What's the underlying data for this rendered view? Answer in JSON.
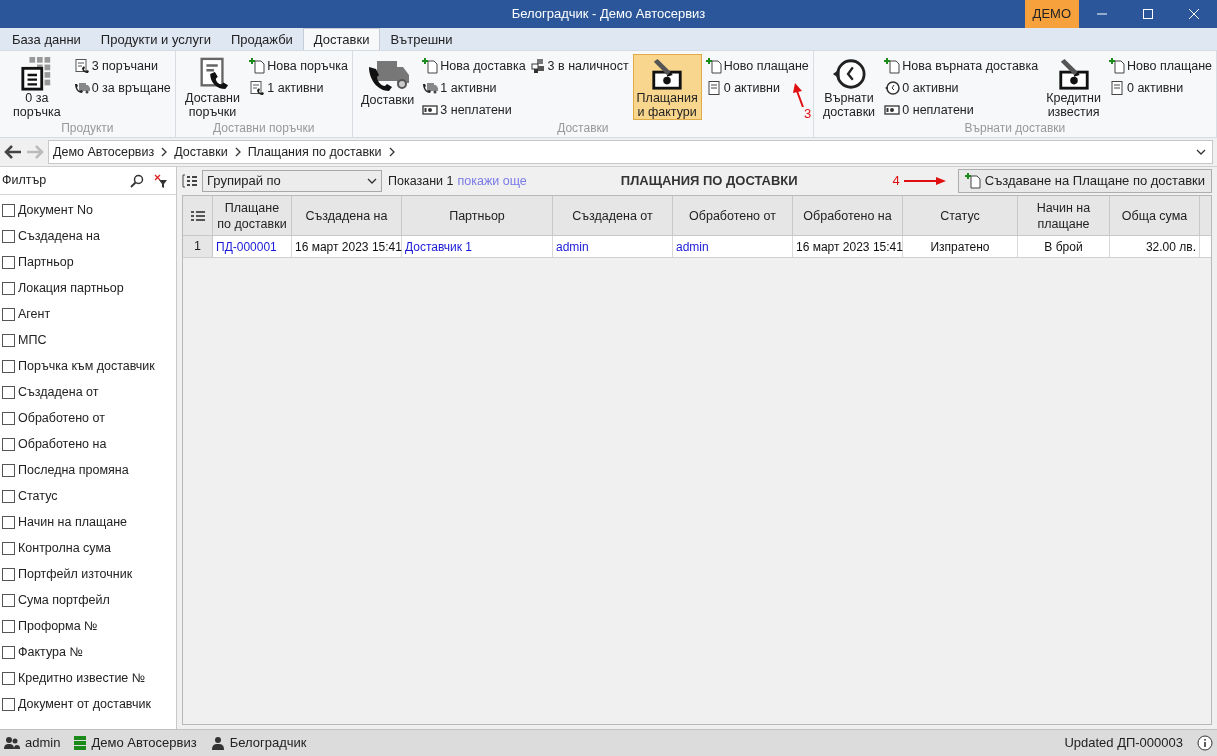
{
  "window": {
    "title": "Белоградчик - Демо Автосервиз",
    "badge": "ДЕМО"
  },
  "tabs": [
    {
      "label": "База данни",
      "selected": false
    },
    {
      "label": "Продукти и услуги",
      "selected": false
    },
    {
      "label": "Продажби",
      "selected": false
    },
    {
      "label": "Доставки",
      "selected": true
    },
    {
      "label": "Вътрешни",
      "selected": false
    }
  ],
  "ribbon": {
    "groups": [
      {
        "label": "Продукти",
        "items": [
          {
            "kind": "large",
            "label": "0 за поръчка",
            "selected": false
          },
          {
            "kind": "stack",
            "entries": [
              "3 поръчани",
              "0 за връщане"
            ]
          }
        ]
      },
      {
        "label": "Доставни поръчки",
        "items": [
          {
            "kind": "large",
            "label": "Доставни поръчки",
            "selected": false
          },
          {
            "kind": "stack",
            "entries": [
              "Нова поръчка",
              "1 активни"
            ]
          }
        ]
      },
      {
        "label": "Доставки",
        "items": [
          {
            "kind": "large",
            "label": "Доставки",
            "selected": false
          },
          {
            "kind": "stack",
            "entries": [
              "Нова доставка",
              "1 активни",
              "3 неплатени"
            ]
          },
          {
            "kind": "stack",
            "entries": [
              "3 в наличност"
            ]
          },
          {
            "kind": "large",
            "label": "Плащания и фактури",
            "selected": true
          },
          {
            "kind": "stack",
            "entries": [
              "Ново плащане",
              "0 активни"
            ]
          }
        ]
      },
      {
        "label": "Върнати доставки",
        "items": [
          {
            "kind": "large",
            "label": "Върнати доставки",
            "selected": false
          },
          {
            "kind": "stack",
            "entries": [
              "Нова върната доставка",
              "0 активни",
              "0 неплатени"
            ]
          },
          {
            "kind": "large",
            "label": "Кредитни известия",
            "selected": false
          },
          {
            "kind": "stack",
            "entries": [
              "Ново плащане",
              "0 активни"
            ]
          }
        ]
      }
    ]
  },
  "annotations": [
    "3",
    "4"
  ],
  "breadcrumb": [
    "Демо Автосервиз",
    "Доставки",
    "Плащания по доставки"
  ],
  "filter": {
    "title": "Филтър",
    "items": [
      {
        "label": "Документ No",
        "checked": false
      },
      {
        "label": "Създадена на",
        "checked": false
      },
      {
        "label": "Партньор",
        "checked": false
      },
      {
        "label": "Локация партньор",
        "checked": false
      },
      {
        "label": "Агент",
        "checked": false
      },
      {
        "label": "МПС",
        "checked": false
      },
      {
        "label": "Поръчка към доставчик",
        "checked": false
      },
      {
        "label": "Създадена от",
        "checked": false
      },
      {
        "label": "Обработено от",
        "checked": false
      },
      {
        "label": "Обработено на",
        "checked": false
      },
      {
        "label": "Последна промяна",
        "checked": false
      },
      {
        "label": "Статус",
        "checked": false
      },
      {
        "label": "Начин на плащане",
        "checked": false
      },
      {
        "label": "Контролна сума",
        "checked": false
      },
      {
        "label": "Портфейл източник",
        "checked": false
      },
      {
        "label": "Сума портфейл",
        "checked": false
      },
      {
        "label": "Проформа №",
        "checked": false
      },
      {
        "label": "Фактура №",
        "checked": false
      },
      {
        "label": "Кредитно известие №",
        "checked": false
      },
      {
        "label": "Документ от доставчик",
        "checked": false
      }
    ]
  },
  "toolbar": {
    "group_by": "Групирай по",
    "shown": "Показани 1",
    "show_more": "покажи още",
    "title": "ПЛАЩАНИЯ ПО ДОСТАВКИ",
    "create_button": "Създаване на Плащане по доставки"
  },
  "table": {
    "columns": [
      "Плащане по доставки",
      "Създадена на",
      "Партньор",
      "Създадена от",
      "Обработено от",
      "Обработено на",
      "Статус",
      "Начин на плащане",
      "Обща сума"
    ],
    "rows": [
      {
        "number": "1",
        "cells": [
          {
            "text": "ПД-000001",
            "link": true
          },
          {
            "text": "16 март 2023 15:41",
            "link": false
          },
          {
            "text": "Доставчик 1",
            "link": true
          },
          {
            "text": "admin",
            "link": true
          },
          {
            "text": "admin",
            "link": true
          },
          {
            "text": "16 март 2023 15:41",
            "link": false
          },
          {
            "text": "Изпратено",
            "link": false
          },
          {
            "text": "В брой",
            "link": false
          },
          {
            "text": "32.00 лв.",
            "link": false
          }
        ]
      }
    ]
  },
  "status_bar": {
    "left": [
      "admin",
      "Демо Автосервиз",
      "Белоградчик"
    ],
    "right": "Updated ДП-000003"
  }
}
